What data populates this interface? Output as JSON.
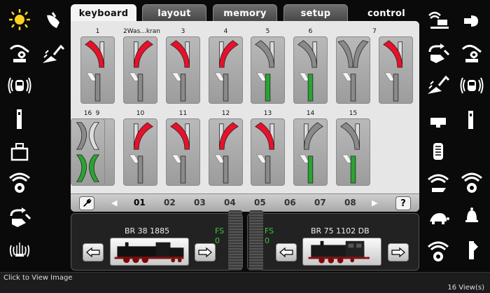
{
  "tabs": [
    {
      "label": "keyboard",
      "state": "active"
    },
    {
      "label": "layout",
      "state": "inactive"
    },
    {
      "label": "memory",
      "state": "inactive"
    },
    {
      "label": "setup",
      "state": "inactive"
    },
    {
      "label": "control",
      "state": "plain"
    }
  ],
  "left_icons": [
    "light-bulb-icon",
    "hand-pointer-icon",
    "crane-hook-icon",
    "excavator-icon",
    "radio-locomotive-icon",
    "signal-post-icon",
    "weight-icon",
    "smoke-generator-icon",
    "coupling-rotate-icon",
    "fountain-icon"
  ],
  "right_icons": [
    "conveyor-icon",
    "horn-icon",
    "coupling-rotate-icon",
    "crane-hook-icon",
    "excavator-icon",
    "radio-locomotive-icon",
    "whistle-icon",
    "diesel-engine-icon",
    "pantograph-icon",
    "smoke-generator-icon",
    "turtle-icon",
    "bell-icon",
    "radio-wheel-icon",
    "signal-post-icon"
  ],
  "switches": [
    {
      "label": "1",
      "top": "curve-left",
      "top_color": "red",
      "bottom": "y-straight",
      "bottom_color": "gray"
    },
    {
      "label": "2Was...kran",
      "top": "curve-right",
      "top_color": "red",
      "bottom": "y-straight",
      "bottom_color": "gray"
    },
    {
      "label": "3",
      "top": "curve-left",
      "top_color": "red",
      "bottom": "y-straight",
      "bottom_color": "gray"
    },
    {
      "label": "4",
      "top": "curve-right",
      "top_color": "red",
      "bottom": "y-straight",
      "bottom_color": "gray"
    },
    {
      "label": "5",
      "top": "curve-left",
      "top_color": "gray",
      "bottom": "y-straight",
      "bottom_color": "green"
    },
    {
      "label": "6",
      "top": "curve-left",
      "top_color": "gray",
      "bottom": "y-straight",
      "bottom_color": "green"
    },
    {
      "label": "7",
      "top": "y-both",
      "top_color": "gray",
      "bottom": "y-straight",
      "bottom_color": "gray",
      "wide": true
    },
    {
      "label": "9",
      "top": "curve-left",
      "top_color": "red",
      "bottom": "y-straight",
      "bottom_color": "gray"
    },
    {
      "label": "10",
      "top": "curve-right",
      "top_color": "red",
      "bottom": "y-straight",
      "bottom_color": "gray"
    },
    {
      "label": "11",
      "top": "curve-left",
      "top_color": "red",
      "bottom": "y-straight",
      "bottom_color": "gray"
    },
    {
      "label": "12",
      "top": "curve-right",
      "top_color": "red",
      "bottom": "y-straight",
      "bottom_color": "gray"
    },
    {
      "label": "13",
      "top": "curve-left",
      "top_color": "red",
      "bottom": "y-straight",
      "bottom_color": "gray"
    },
    {
      "label": "14",
      "top": "curve-right",
      "top_color": "gray",
      "bottom": "y-straight",
      "bottom_color": "green"
    },
    {
      "label": "15",
      "top": "curve-left",
      "top_color": "gray",
      "bottom": "y-straight",
      "bottom_color": "green"
    },
    {
      "label": "16",
      "top": "cross-curve",
      "top_color": "gray",
      "bottom": "cross-curve",
      "bottom_color": "green"
    }
  ],
  "pagebar": {
    "tool_icon": "wrench-icon",
    "pages": [
      "01",
      "02",
      "03",
      "04",
      "05",
      "06",
      "07",
      "08"
    ],
    "current_page": "01",
    "help_label": "?"
  },
  "cabs": [
    {
      "name": "BR 38 1885",
      "fs_label": "FS",
      "fs_value": "0",
      "image": "steam-locomotive"
    },
    {
      "name": "BR 75 1102 DB",
      "fs_label": "FS",
      "fs_value": "0",
      "image": "tank-locomotive"
    }
  ],
  "status": {
    "left": "Click to View Image",
    "right": "16 View(s)"
  },
  "colors": {
    "red": "#e8102a",
    "green": "#2aa332",
    "gray": "#8a8a8a",
    "panel": "#e6e6e6",
    "icon": "#ffffff",
    "sun": "#ffd21f"
  }
}
